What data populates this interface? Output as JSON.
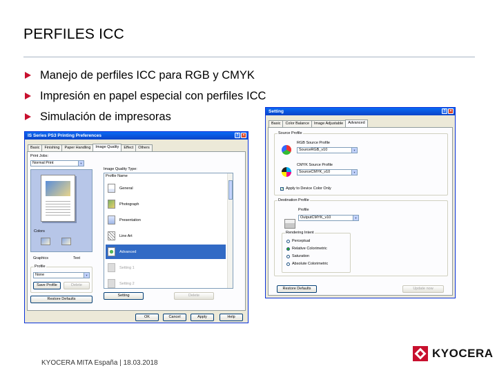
{
  "slide": {
    "title": "PERFILES ICC",
    "bullets": [
      "Manejo de perfiles ICC para RGB y CMYK",
      "Impresión en papel especial con perfiles ICC",
      "Simulación de impresoras"
    ],
    "footer": "KYOCERA MITA España | 18.03.2018",
    "logo_text": "KYOCERA",
    "accent_color": "#c8102e"
  },
  "printing_prefs": {
    "title": "IS Series PS3 Printing Preferences",
    "tabs": [
      "Basic",
      "Finishing",
      "Paper Handling",
      "Image Quality",
      "Effect",
      "Others"
    ],
    "active_tab": "Image Quality",
    "print_jobs_label": "Print Jobs:",
    "print_jobs_value": "Normal Print",
    "colors_label": "Colors",
    "image_quality_type_label": "Image Quality Type:",
    "list_header": "Profile Name",
    "list_items": [
      "General",
      "Photograph",
      "Presentation",
      "Line Art",
      "Advanced",
      "Setting 1",
      "Setting 2"
    ],
    "selected_item": "Advanced",
    "mode_graphics": "Graphics",
    "mode_text": "Text",
    "profile_group": "Profile",
    "profile_value": "None",
    "save_profile": "Save Profile",
    "delete_profile": "Delete",
    "restore_defaults": "Restore Defaults",
    "setting_btn": "Setting",
    "delete_btn": "Delete",
    "ok": "OK",
    "cancel": "Cancel",
    "apply": "Apply",
    "help": "Help"
  },
  "setting_dialog": {
    "title": "Setting",
    "tabs": [
      "Basic",
      "Color Balance",
      "Image Adjustable",
      "Advanced"
    ],
    "active_tab": "Advanced",
    "source_profile_group": "Source Profile",
    "rgb_source_label": "RGB Source Profile",
    "rgb_source_value": "SourceRGB_v10",
    "cmyk_source_label": "CMYK Source Profile",
    "cmyk_source_value": "SourceCMYK_v10",
    "apply_device_color": "Apply to Device Color Only",
    "destination_group": "Destination Profile",
    "profile_label": "Profile",
    "profile_value": "OutputCMYK_v10",
    "rendering_group": "Rendering Intent",
    "rendering_options": [
      "Perceptual",
      "Relative Colorimetric",
      "Saturation",
      "Absolute Colorimetric"
    ],
    "rendering_selected": "Relative Colorimetric",
    "restore_defaults": "Restore Defaults",
    "update_now": "Update now"
  }
}
